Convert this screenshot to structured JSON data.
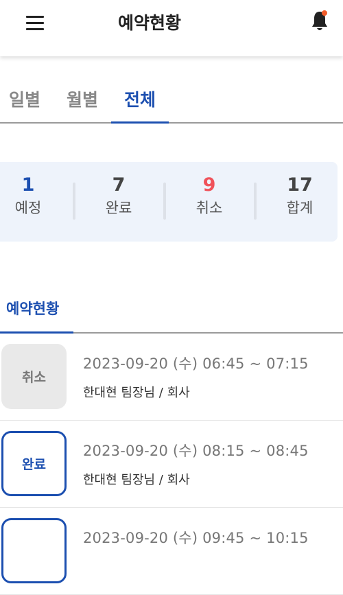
{
  "header": {
    "title": "예약현황",
    "menu_icon": "hamburger-menu-icon",
    "bell_icon": "bell-icon",
    "accent": "#1c4fb0",
    "notification_dot_color": "#f25c2a"
  },
  "tabs": [
    {
      "label": "일별",
      "active": false
    },
    {
      "label": "월별",
      "active": false
    },
    {
      "label": "전체",
      "active": true
    }
  ],
  "summary": {
    "scheduled": {
      "value": "1",
      "label": "예정"
    },
    "completed": {
      "value": "7",
      "label": "완료"
    },
    "cancelled": {
      "value": "9",
      "label": "취소"
    },
    "total": {
      "value": "17",
      "label": "합계"
    }
  },
  "section": {
    "title": "예약현황"
  },
  "reservations": [
    {
      "status": "취소",
      "time": "2023-09-20 (수) 06:45 ~ 07:15",
      "detail": "한대현 팀장님 / 회사"
    },
    {
      "status": "완료",
      "time": "2023-09-20 (수) 08:15 ~ 08:45",
      "detail": "한대현 팀장님 / 회사"
    },
    {
      "status": "",
      "time": "2023-09-20 (수) 09:45 ~ 10:15",
      "detail": ""
    }
  ]
}
